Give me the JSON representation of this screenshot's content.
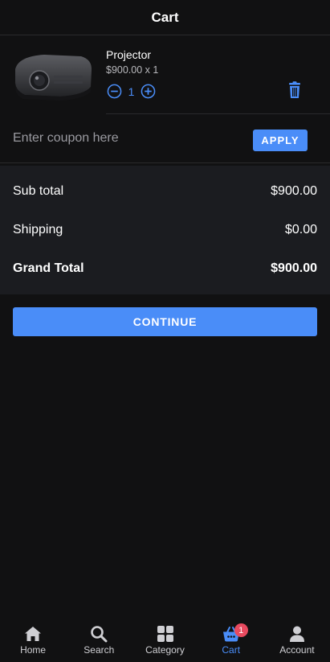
{
  "header": {
    "title": "Cart"
  },
  "item": {
    "name": "Projector",
    "price_line": "$900.00 x 1",
    "quantity": "1"
  },
  "coupon": {
    "placeholder": "Enter coupon here",
    "apply_label": "APPLY"
  },
  "summary": {
    "subtotal_label": "Sub total",
    "subtotal_value": "$900.00",
    "shipping_label": "Shipping",
    "shipping_value": "$0.00",
    "grand_label": "Grand Total",
    "grand_value": "$900.00"
  },
  "continue_label": "CONTINUE",
  "nav": {
    "items": [
      {
        "label": "Home",
        "icon": "home-icon"
      },
      {
        "label": "Search",
        "icon": "search-icon"
      },
      {
        "label": "Category",
        "icon": "grid-icon"
      },
      {
        "label": "Cart",
        "icon": "cart-icon",
        "badge": "1",
        "active": true
      },
      {
        "label": "Account",
        "icon": "user-icon"
      }
    ]
  },
  "colors": {
    "accent": "#4a8df8",
    "badge": "#e84a5f",
    "background": "#111112",
    "panel": "#1b1c20"
  }
}
